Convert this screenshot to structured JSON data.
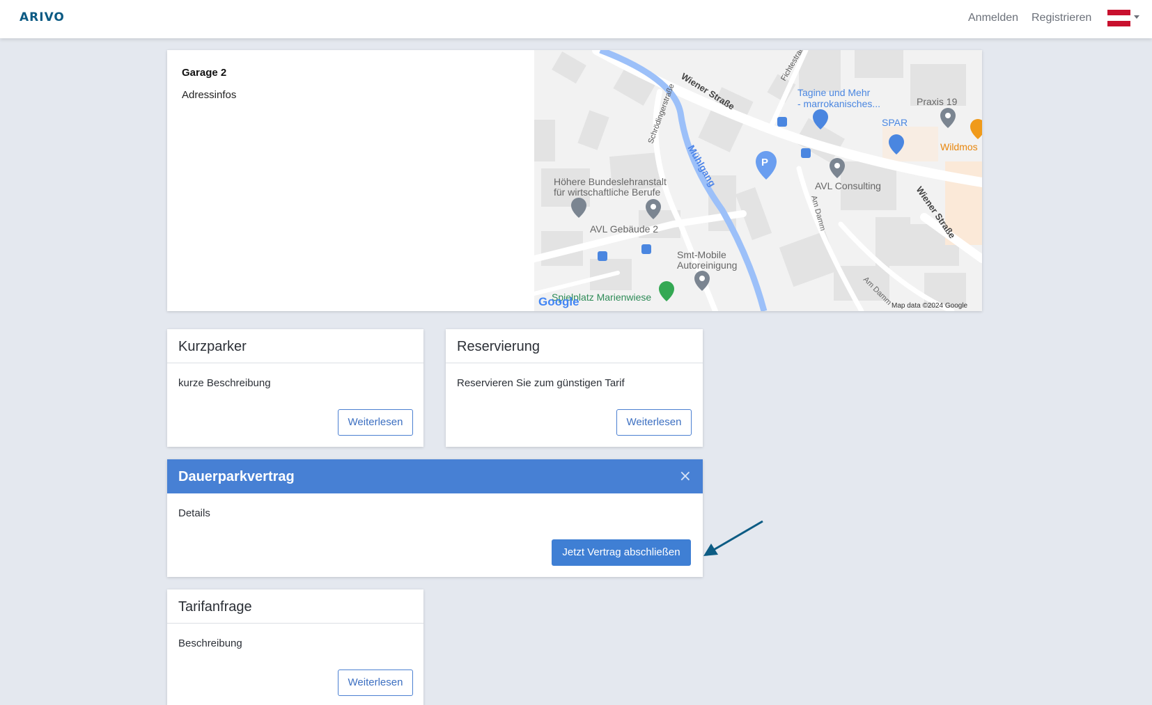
{
  "header": {
    "logo": "ARIVO",
    "login": "Anmelden",
    "register": "Registrieren",
    "flag_colors": [
      "#c8102e",
      "#ffffff",
      "#c8102e"
    ]
  },
  "garage": {
    "title": "Garage 2",
    "subtitle": "Adressinfos",
    "map": {
      "labels": {
        "wiener_strasse_1": "Wiener Straße",
        "wiener_strasse_2": "Wiener Straße",
        "fichtestr": "Fichtestraße",
        "schroedinger": "Schrödingerstraße",
        "muehlgang": "Mühlgang",
        "tagine": "Tagine und Mehr",
        "tagine2": "- marrokanisches...",
        "praxis": "Praxis 19",
        "spar": "SPAR",
        "wildmos": "Wildmos",
        "school1": "Höhere Bundeslehranstalt",
        "school2": "für wirtschaftliche Berufe",
        "avl_consulting": "AVL Consulting",
        "am_damm_1": "Am Damm",
        "am_damm_2": "Am Damm",
        "avl_gebaeude": "AVL Gebäude 2",
        "smt1": "Smt-Mobile",
        "smt2": "Autoreinigung",
        "spielplatz": "Spielplatz Marienwiese",
        "google": "Google",
        "attribution": "Map data ©2024 Google",
        "parking": "P"
      }
    }
  },
  "cards": {
    "kurzparker": {
      "title": "Kurzparker",
      "text": "kurze Beschreibung",
      "button": "Weiterlesen"
    },
    "reservierung": {
      "title": "Reservierung",
      "text": "Reservieren Sie zum günstigen Tarif",
      "button": "Weiterlesen"
    },
    "dauerpark": {
      "title": "Dauerparkvertrag",
      "text": "Details",
      "button": "Jetzt Vertrag abschließen",
      "close": "×",
      "accent": "#4780d4"
    },
    "tarif": {
      "title": "Tarifanfrage",
      "text": "Beschreibung",
      "button": "Weiterlesen"
    }
  }
}
